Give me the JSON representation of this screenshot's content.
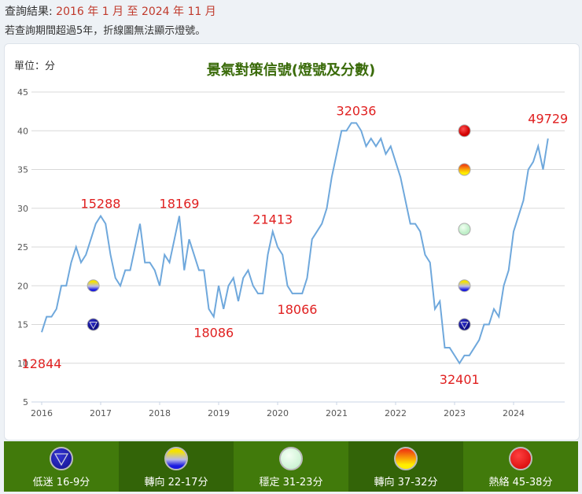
{
  "header": {
    "query_label": "查詢結果:",
    "query_range": "2016 年 1 月 至 2024 年 11 月",
    "note": "若查詢期間超過5年，折線圖無法顯示燈號。"
  },
  "chart_data": {
    "type": "line",
    "title": "景氣對策信號(燈號及分數)",
    "unit_label": "單位：分",
    "ylim": [
      5,
      45
    ],
    "yticks": [
      5,
      10,
      15,
      20,
      25,
      30,
      35,
      40,
      45
    ],
    "xticks": [
      "2016",
      "2017",
      "2018",
      "2019",
      "2020",
      "2021",
      "2022",
      "2023",
      "2024"
    ],
    "x_start": "2016-01",
    "series": [
      {
        "name": "分數",
        "color": "#6fa8dc",
        "values": [
          14,
          16,
          16,
          17,
          20,
          20,
          23,
          25,
          23,
          24,
          26,
          28,
          29,
          28,
          24,
          21,
          20,
          22,
          22,
          25,
          28,
          23,
          23,
          22,
          20,
          24,
          23,
          26,
          29,
          22,
          26,
          24,
          22,
          22,
          17,
          16,
          20,
          17,
          20,
          21,
          18,
          21,
          22,
          20,
          19,
          19,
          24,
          27,
          25,
          24,
          20,
          19,
          19,
          19,
          21,
          26,
          27,
          28,
          30,
          34,
          37,
          40,
          40,
          41,
          41,
          40,
          38,
          39,
          38,
          39,
          37,
          38,
          36,
          34,
          31,
          28,
          28,
          27,
          24,
          23,
          17,
          18,
          12,
          12,
          11,
          10,
          11,
          11,
          12,
          13,
          15,
          15,
          17,
          16,
          20,
          22,
          27,
          29,
          31,
          35,
          36,
          38,
          35,
          39
        ]
      }
    ],
    "annotations": [
      {
        "text": "12844",
        "month": 0,
        "value": 12,
        "pos": "below"
      },
      {
        "text": "15288",
        "month": 12,
        "value": 29,
        "pos": "above"
      },
      {
        "text": "18169",
        "month": 28,
        "value": 29,
        "pos": "above"
      },
      {
        "text": "18086",
        "month": 35,
        "value": 16,
        "pos": "below"
      },
      {
        "text": "21413",
        "month": 47,
        "value": 27,
        "pos": "above"
      },
      {
        "text": "18066",
        "month": 52,
        "value": 19,
        "pos": "below"
      },
      {
        "text": "32036",
        "month": 64,
        "value": 41,
        "pos": "above"
      },
      {
        "text": "32401",
        "month": 85,
        "value": 10,
        "pos": "below"
      },
      {
        "text": "49729",
        "month": 103,
        "value": 40,
        "pos": "above"
      }
    ],
    "signal_markers": [
      {
        "month": 10.5,
        "value": 20,
        "signal": "yellow-blue"
      },
      {
        "month": 10.5,
        "value": 15,
        "signal": "blue"
      },
      {
        "month": 86,
        "value": 40,
        "signal": "red"
      },
      {
        "month": 86,
        "value": 35,
        "signal": "yellow-red"
      },
      {
        "month": 86,
        "value": 27.3,
        "signal": "green"
      },
      {
        "month": 86,
        "value": 20,
        "signal": "yellow-blue"
      },
      {
        "month": 86,
        "value": 15,
        "signal": "blue"
      }
    ]
  },
  "legend": [
    {
      "label": "低迷 16-9分",
      "signal": "blue"
    },
    {
      "label": "轉向 22-17分",
      "signal": "yellow-blue"
    },
    {
      "label": "穩定 31-23分",
      "signal": "green"
    },
    {
      "label": "轉向 37-32分",
      "signal": "yellow-red"
    },
    {
      "label": "熱絡 45-38分",
      "signal": "red"
    }
  ]
}
